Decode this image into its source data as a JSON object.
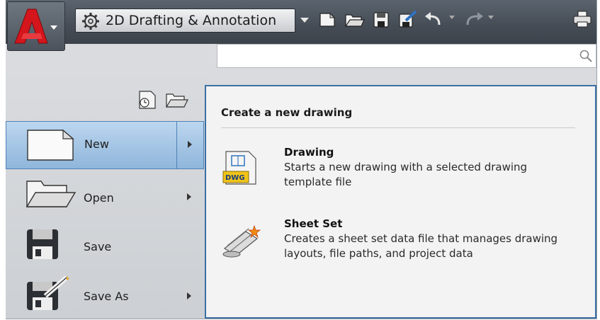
{
  "quick_access_toolbar": {
    "workspace": "2D Drafting & Annotation",
    "icons": [
      "application-menu-icon",
      "gear-icon",
      "new-icon",
      "open-icon",
      "save-icon",
      "save-as-icon",
      "undo-icon",
      "redo-icon",
      "plot-icon"
    ]
  },
  "search": {
    "placeholder": "",
    "icon": "search-icon"
  },
  "left_pane": {
    "icons": [
      "recent-documents-icon",
      "open-documents-icon"
    ],
    "items": [
      {
        "label": "New",
        "has_submenu": true,
        "active": true
      },
      {
        "label": "Open",
        "has_submenu": true,
        "active": false
      },
      {
        "label": "Save",
        "has_submenu": false,
        "active": false
      },
      {
        "label": "Save As",
        "has_submenu": true,
        "active": false
      }
    ]
  },
  "flyout": {
    "title": "Create a new drawing",
    "entries": [
      {
        "heading": "Drawing",
        "description": "Starts a new drawing with a selected drawing template file",
        "icon": "dwg-file-icon",
        "icon_text": "DWG"
      },
      {
        "heading": "Sheet Set",
        "description": "Creates a sheet set data file that manages drawing layouts, file paths, and project data",
        "icon": "sheet-set-icon"
      }
    ]
  },
  "colors": {
    "accent": "#3c6fa5",
    "active_item": "#a9c8e6",
    "toolbar": "#4c535c",
    "pane": "#d9dbde",
    "brand_red": "#c8141a"
  }
}
